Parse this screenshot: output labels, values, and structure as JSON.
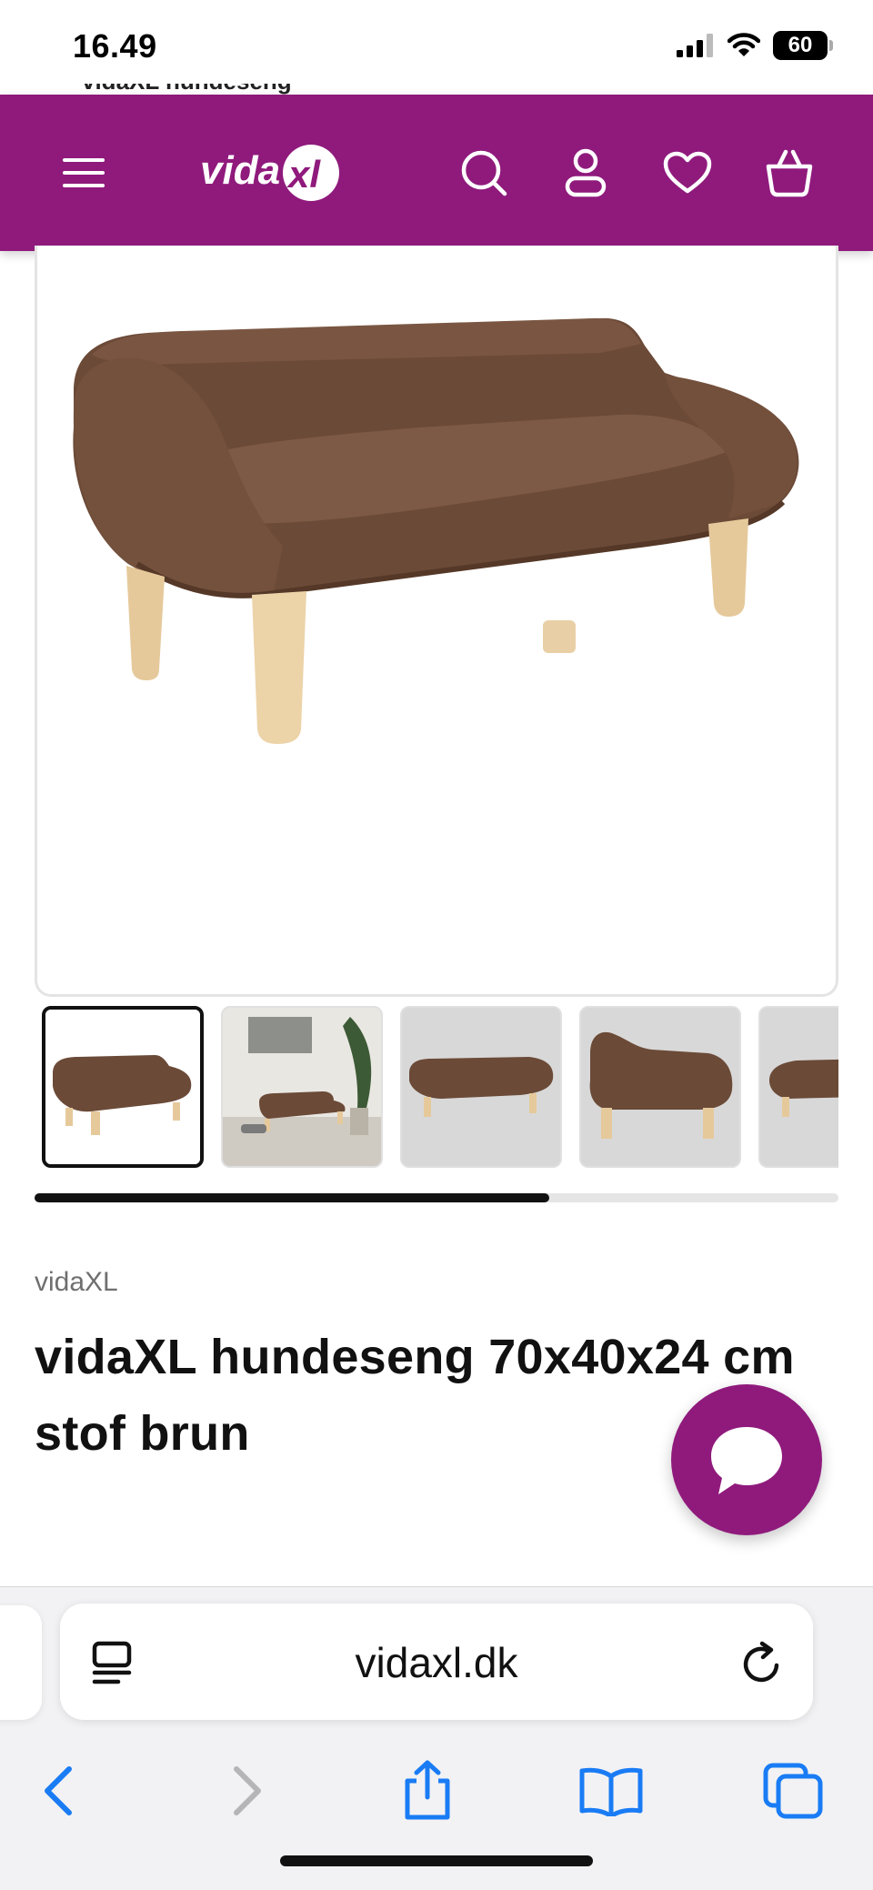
{
  "status_bar": {
    "time": "16.49",
    "battery": "60"
  },
  "header": {
    "logo": "vidaXL",
    "menu_icon": "hamburger-menu-icon",
    "search_icon": "search-icon",
    "account_icon": "account-icon",
    "wishlist_icon": "heart-icon",
    "cart_icon": "basket-icon",
    "background_color": "#8f1a7c"
  },
  "peek_text": "vidaXL hundeseng",
  "gallery": {
    "thumbnail_count": 5,
    "active_index": 0,
    "scroll_progress": 0.64
  },
  "product": {
    "brand": "vidaXL",
    "title": "vidaXL hundeseng 70x40x24 cm stof brun",
    "color": "#6e4e3a"
  },
  "chat": {
    "icon": "chat-bubble-icon"
  },
  "browser": {
    "url": "vidaxl.dk",
    "accent_color": "#1a7cf5",
    "icons": {
      "reader": "reader-mode-icon",
      "reload": "reload-icon",
      "back": "back-arrow-icon",
      "forward": "forward-arrow-icon",
      "share": "share-icon",
      "bookmarks": "bookmarks-icon",
      "tabs": "tabs-icon"
    }
  }
}
